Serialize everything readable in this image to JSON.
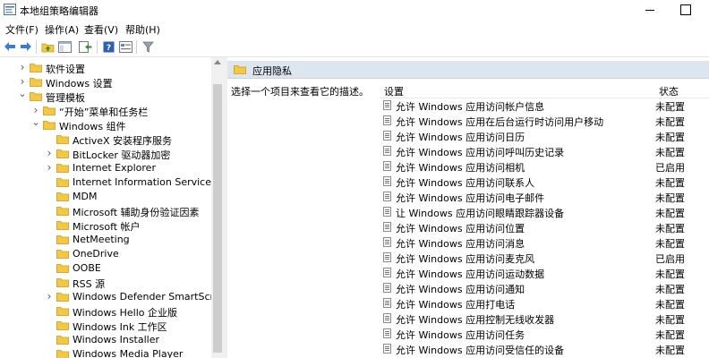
{
  "window": {
    "title": "本地组策略编辑器"
  },
  "menu": [
    "文件(F)",
    "操作(A)",
    "查看(V)",
    "帮助(H)"
  ],
  "toolbar": {
    "icons": [
      "back-arrow-icon",
      "forward-arrow-icon",
      "up-folder-icon",
      "show-hide-tree-icon",
      "export-list-icon",
      "help-icon",
      "properties-icon",
      "filter-icon"
    ]
  },
  "tree": [
    {
      "label": "软件设置",
      "level": 1,
      "expander": "collapsed"
    },
    {
      "label": "Windows 设置",
      "level": 1,
      "expander": "collapsed"
    },
    {
      "label": "管理模板",
      "level": 1,
      "expander": "expanded"
    },
    {
      "label": "“开始”菜单和任务栏",
      "level": 2,
      "expander": "collapsed"
    },
    {
      "label": "Windows 组件",
      "level": 2,
      "expander": "expanded"
    },
    {
      "label": "ActiveX 安装程序服务",
      "level": 3,
      "expander": "none"
    },
    {
      "label": "BitLocker 驱动器加密",
      "level": 3,
      "expander": "collapsed"
    },
    {
      "label": "Internet Explorer",
      "level": 3,
      "expander": "collapsed"
    },
    {
      "label": "Internet Information Services",
      "level": 3,
      "expander": "none"
    },
    {
      "label": "MDM",
      "level": 3,
      "expander": "none"
    },
    {
      "label": "Microsoft 辅助身份验证因素",
      "level": 3,
      "expander": "none"
    },
    {
      "label": "Microsoft 帐户",
      "level": 3,
      "expander": "none"
    },
    {
      "label": "NetMeeting",
      "level": 3,
      "expander": "none"
    },
    {
      "label": "OneDrive",
      "level": 3,
      "expander": "none"
    },
    {
      "label": "OOBE",
      "level": 3,
      "expander": "none"
    },
    {
      "label": "RSS 源",
      "level": 3,
      "expander": "none"
    },
    {
      "label": "Windows Defender SmartScreen",
      "level": 3,
      "expander": "collapsed"
    },
    {
      "label": "Windows Hello 企业版",
      "level": 3,
      "expander": "none"
    },
    {
      "label": "Windows Ink 工作区",
      "level": 3,
      "expander": "none"
    },
    {
      "label": "Windows Installer",
      "level": 3,
      "expander": "none"
    },
    {
      "label": "Windows Media Player",
      "level": 3,
      "expander": "none"
    }
  ],
  "right": {
    "header": "应用隐私",
    "description": "选择一个项目来查看它的描述。",
    "col_setting": "设置",
    "col_state": "状态",
    "rows": [
      {
        "name": "允许 Windows 应用访问帐户信息",
        "state": "未配置"
      },
      {
        "name": "允许 Windows 应用在后台运行时访问用户移动",
        "state": "未配置"
      },
      {
        "name": "允许 Windows 应用访问日历",
        "state": "未配置"
      },
      {
        "name": "允许 Windows 应用访问呼叫历史记录",
        "state": "未配置"
      },
      {
        "name": "允许 Windows 应用访问相机",
        "state": "已启用"
      },
      {
        "name": "允许 Windows 应用访问联系人",
        "state": "未配置"
      },
      {
        "name": "允许 Windows 应用访问电子邮件",
        "state": "未配置"
      },
      {
        "name": "让 Windows 应用访问眼睛跟踪器设备",
        "state": "未配置"
      },
      {
        "name": "允许 Windows 应用访问位置",
        "state": "未配置"
      },
      {
        "name": "允许 Windows 应用访问消息",
        "state": "未配置"
      },
      {
        "name": "允许 Windows 应用访问麦克风",
        "state": "已启用"
      },
      {
        "name": "允许 Windows 应用访问运动数据",
        "state": "未配置"
      },
      {
        "name": "允许 Windows 应用访问通知",
        "state": "未配置"
      },
      {
        "name": "允许 Windows 应用打电话",
        "state": "未配置"
      },
      {
        "name": "允许 Windows 应用控制无线收发器",
        "state": "未配置"
      },
      {
        "name": "允许 Windows 应用访问任务",
        "state": "未配置"
      },
      {
        "name": "允许 Windows 应用访问受信任的设备",
        "state": "未配置"
      }
    ]
  },
  "colors": {
    "folder": "#f5c842",
    "header_bg": "#dde6ef"
  }
}
